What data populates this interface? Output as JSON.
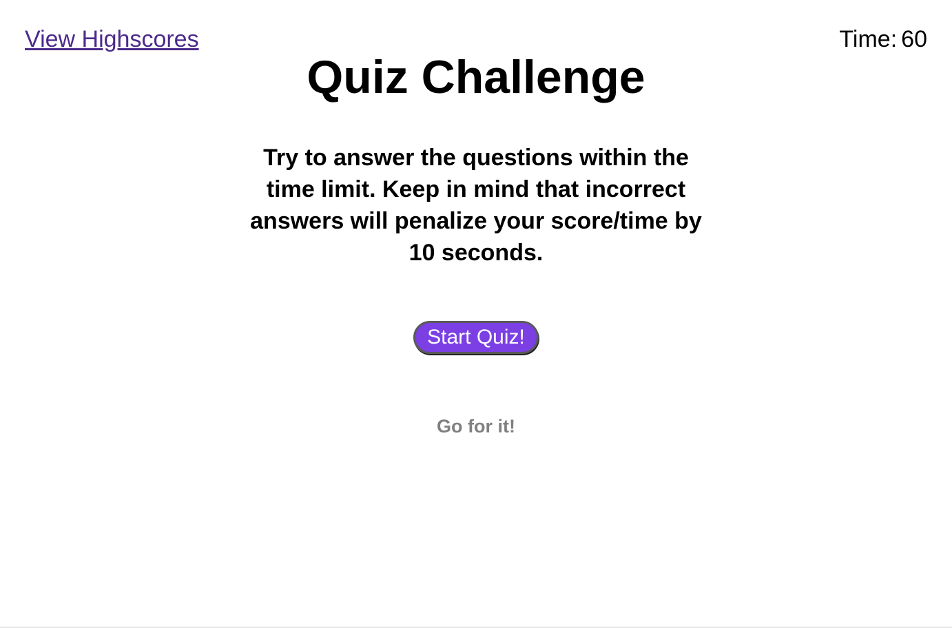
{
  "header": {
    "highscores_link": "View Highscores",
    "timer_label": "Time:",
    "timer_value": "60"
  },
  "main": {
    "title": "Quiz Challenge",
    "instructions": "Try to answer the questions within the time limit. Keep in mind that incorrect answers will penalize your score/time by 10 seconds.",
    "start_button": "Start Quiz!",
    "footer_message": "Go for it!"
  },
  "colors": {
    "button_background": "#7b3fe4",
    "link": "#4b2a8a",
    "footer_text": "#808080"
  }
}
